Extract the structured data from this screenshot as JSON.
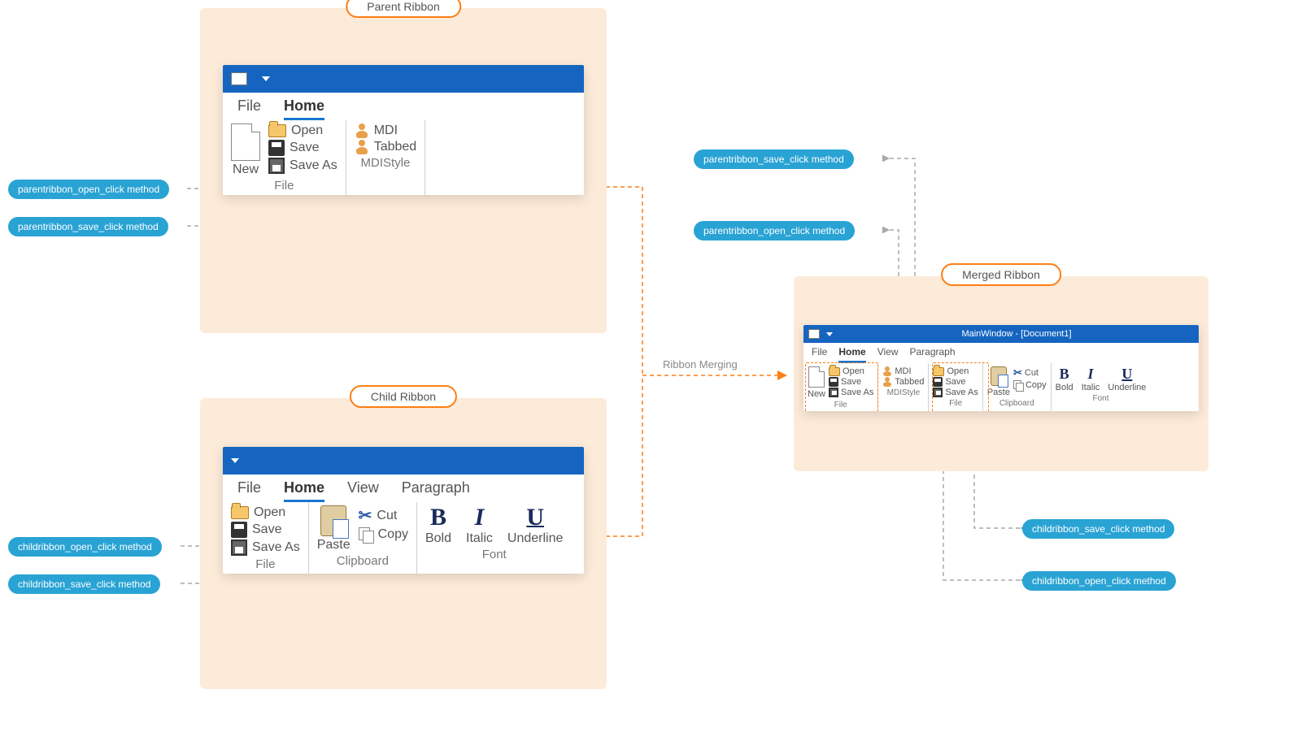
{
  "labels": {
    "parent_title": "Parent Ribbon",
    "child_title": "Child Ribbon",
    "merged_title": "Merged Ribbon",
    "merge_arrow": "Ribbon Merging"
  },
  "pills": {
    "parent_open": "parentribbon_open_click method",
    "parent_save": "parentribbon_save_click method",
    "child_open": "childribbon_open_click method",
    "child_save": "childribbon_save_click method",
    "merged_parent_save": "parentribbon_save_click method",
    "merged_parent_open": "parentribbon_open_click method",
    "merged_child_save": "childribbon_save_click method",
    "merged_child_open": "childribbon_open_click method"
  },
  "parent": {
    "tabs": {
      "file": "File",
      "home": "Home"
    },
    "file_group": {
      "new": "New",
      "open": "Open",
      "save": "Save",
      "saveas": "Save As",
      "label": "File"
    },
    "mdi_group": {
      "mdi": "MDI",
      "tabbed": "Tabbed",
      "label": "MDIStyle"
    }
  },
  "child": {
    "tabs": {
      "file": "File",
      "home": "Home",
      "view": "View",
      "paragraph": "Paragraph"
    },
    "file_group": {
      "open": "Open",
      "save": "Save",
      "saveas": "Save As",
      "label": "File"
    },
    "clip_group": {
      "paste": "Paste",
      "cut": "Cut",
      "copy": "Copy",
      "label": "Clipboard"
    },
    "font_group": {
      "bold": "Bold",
      "italic": "Italic",
      "underline": "Underline",
      "label": "Font"
    }
  },
  "merged": {
    "title": "MainWindow - [Document1]",
    "tabs": {
      "file": "File",
      "home": "Home",
      "view": "View",
      "paragraph": "Paragraph"
    },
    "file_group1": {
      "new": "New",
      "open": "Open",
      "save": "Save",
      "saveas": "Save As",
      "label": "File"
    },
    "mdi_group": {
      "mdi": "MDI",
      "tabbed": "Tabbed",
      "label": "MDIStyle"
    },
    "file_group2": {
      "open": "Open",
      "save": "Save",
      "saveas": "Save As",
      "label": "File"
    },
    "clip_group": {
      "paste": "Paste",
      "cut": "Cut",
      "copy": "Copy",
      "label": "Clipboard"
    },
    "font_group": {
      "bold": "Bold",
      "italic": "Italic",
      "underline": "Underline",
      "label": "Font"
    }
  }
}
